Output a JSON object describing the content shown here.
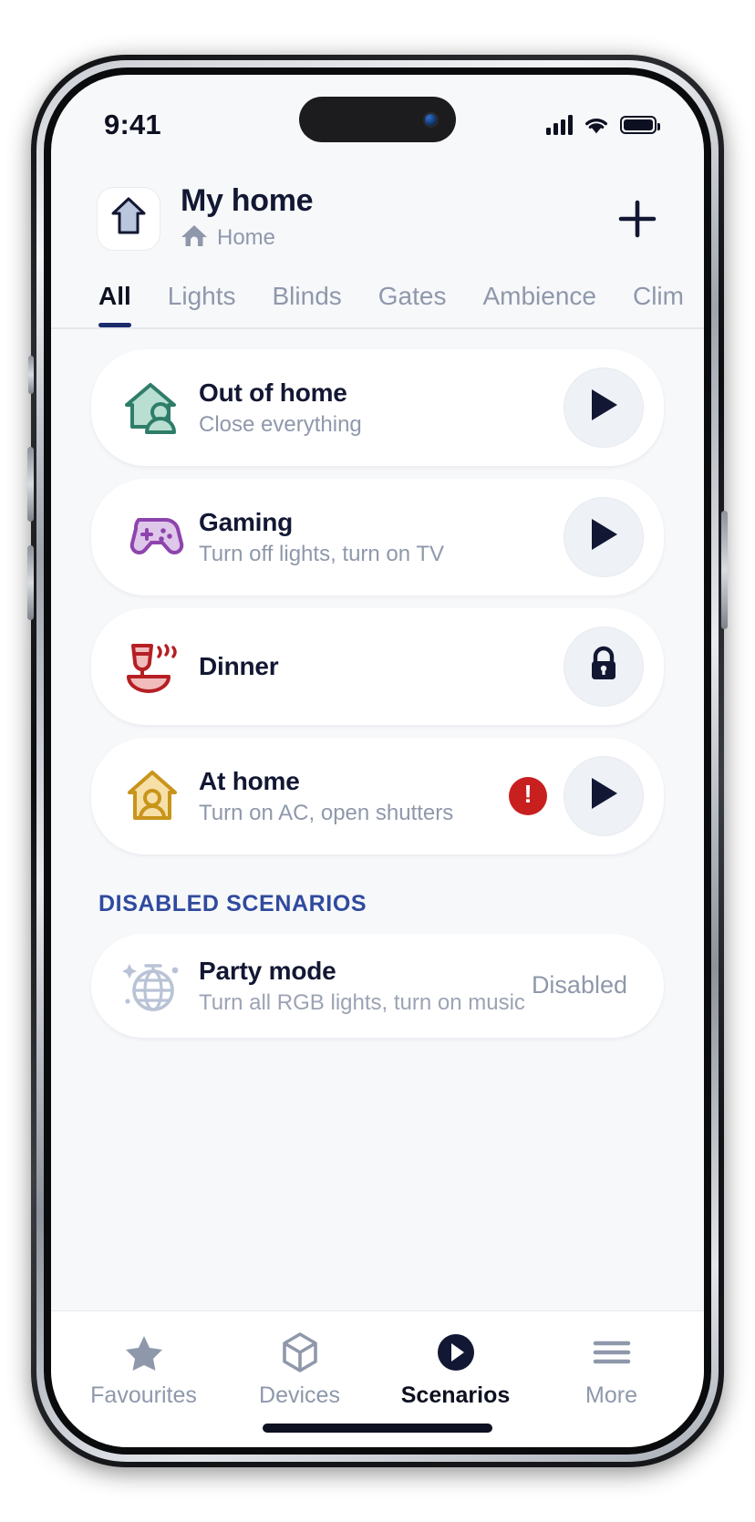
{
  "statusbar": {
    "time": "9:41",
    "signal_icon": "cellular-signal-icon",
    "wifi_icon": "wifi-icon",
    "battery_icon": "battery-full-icon"
  },
  "header": {
    "title": "My home",
    "subtitle": "Home",
    "home_badge_icon": "house-outline-icon",
    "subtitle_icon": "house-filled-icon",
    "add_label": "+",
    "add_icon": "plus-icon"
  },
  "tabs": {
    "items": [
      {
        "label": "All",
        "active": true
      },
      {
        "label": "Lights",
        "active": false
      },
      {
        "label": "Blinds",
        "active": false
      },
      {
        "label": "Gates",
        "active": false
      },
      {
        "label": "Ambience",
        "active": false
      },
      {
        "label": "Clim",
        "active": false
      }
    ]
  },
  "scenarios": {
    "items": [
      {
        "title": "Out of home",
        "subtitle": "Close everything",
        "icon": "house-person-green-icon",
        "action": "play",
        "alert": false
      },
      {
        "title": "Gaming",
        "subtitle": "Turn off lights, turn on TV",
        "icon": "gamepad-purple-icon",
        "action": "play",
        "alert": false
      },
      {
        "title": "Dinner",
        "subtitle": "",
        "icon": "wine-bowl-red-icon",
        "action": "lock",
        "alert": false
      },
      {
        "title": "At home",
        "subtitle": "Turn on AC, open shutters",
        "icon": "house-person-gold-icon",
        "action": "play",
        "alert": true,
        "alert_symbol": "!"
      }
    ]
  },
  "disabled_section": {
    "heading": "DISABLED SCENARIOS",
    "items": [
      {
        "title": "Party mode",
        "subtitle": "Turn all RGB lights, turn on music",
        "icon": "disco-ball-icon",
        "status": "Disabled"
      }
    ]
  },
  "tabbar": {
    "items": [
      {
        "label": "Favourites",
        "icon": "star-icon",
        "active": false
      },
      {
        "label": "Devices",
        "icon": "cube-icon",
        "active": false
      },
      {
        "label": "Scenarios",
        "icon": "play-circle-icon",
        "active": true
      },
      {
        "label": "More",
        "icon": "hamburger-menu-icon",
        "active": false
      }
    ]
  },
  "colors": {
    "accent_dark": "#121733",
    "section_blue": "#2f4a9e",
    "muted": "#8f98ab",
    "alert_red": "#c8201f",
    "green": "#2e7d69",
    "purple": "#8e44ad",
    "gold": "#c8941a",
    "screen_bg": "#f7f8fa"
  }
}
